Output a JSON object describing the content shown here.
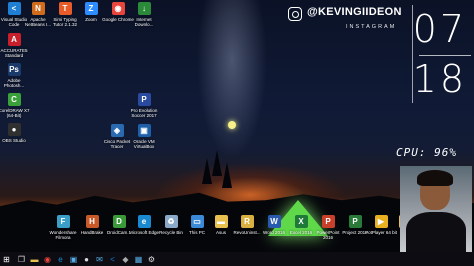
{
  "watermark": {
    "handle": "@KEVINGIIDEON",
    "platform": "INSTAGRAM"
  },
  "clock": {
    "hour": "07",
    "minute": "18"
  },
  "cpu_overlay": "CPU: 96%",
  "desktop_icons": [
    {
      "label": "Visual Studio Code",
      "icon": "vscode-icon",
      "color": "#1f7fd4",
      "glyph": "<"
    },
    {
      "label": "Apache NetBeans I...",
      "icon": "netbeans-icon",
      "color": "#d06c1c",
      "glyph": "N"
    },
    {
      "label": "Simi Typing Tutor 2.1.32",
      "icon": "typing-tutor-icon",
      "color": "#e85c2a",
      "glyph": "T"
    },
    {
      "label": "Zoom",
      "icon": "zoom-icon",
      "color": "#2d8cff",
      "glyph": "Z"
    },
    {
      "label": "Google Chrome",
      "icon": "chrome-icon",
      "color": "#e8453c",
      "glyph": "◉"
    },
    {
      "label": "Internet Downlo...",
      "icon": "internet-download-manager-icon",
      "color": "#2a8a3a",
      "glyph": "↓"
    },
    {
      "label": "ACCURATE5 Standard",
      "icon": "accurate-icon",
      "color": "#c8202a",
      "glyph": "A"
    },
    {
      "label": "Adobe Photosh...",
      "icon": "photoshop-icon",
      "color": "#1a3a6a",
      "glyph": "Ps"
    },
    {
      "label": "CorelDRAW X7 (64-Bit)",
      "icon": "coreldraw-icon",
      "color": "#3aa03a",
      "glyph": "C"
    },
    {
      "label": "OBS Studio",
      "icon": "obs-icon",
      "color": "#303030",
      "glyph": "●"
    },
    {
      "label": "Pro Evolution Soccer 2017",
      "icon": "pes-icon",
      "color": "#2a4aa0",
      "glyph": "P"
    },
    {
      "label": "Cisco Packet Tracer",
      "icon": "packet-tracer-icon",
      "color": "#2a6ab0",
      "glyph": "◈"
    },
    {
      "label": "Oracle VM VirtualBox",
      "icon": "virtualbox-icon",
      "color": "#1d5fa8",
      "glyph": "▣"
    },
    {
      "label": "Wondershare Filmora",
      "icon": "filmora-icon",
      "color": "#3aa0c8",
      "glyph": "F"
    },
    {
      "label": "HandBrake",
      "icon": "handbrake-icon",
      "color": "#c85a2a",
      "glyph": "H"
    },
    {
      "label": "DroidCam...",
      "icon": "droidcam-icon",
      "color": "#3a9a3a",
      "glyph": "D"
    },
    {
      "label": "Microsoft Edge",
      "icon": "edge-icon",
      "color": "#1a8ad0",
      "glyph": "e"
    },
    {
      "label": "Recycle Bin",
      "icon": "recycle-bin-icon",
      "color": "#8aa8c8",
      "glyph": "♻"
    },
    {
      "label": "This PC",
      "icon": "this-pc-icon",
      "color": "#3a8ad8",
      "glyph": "▭"
    },
    {
      "label": "Asus",
      "icon": "folder-icon",
      "color": "#e8c050",
      "glyph": "▬"
    },
    {
      "label": "RevoUninst...",
      "icon": "revo-uninstaller-icon",
      "color": "#d8b040",
      "glyph": "R"
    },
    {
      "label": "Word 2016",
      "icon": "word-icon",
      "color": "#2a5ab0",
      "glyph": "W"
    },
    {
      "label": "Excel 2016",
      "icon": "excel-icon",
      "color": "#1f7a3a",
      "glyph": "X"
    },
    {
      "label": "PowerPoint 2016",
      "icon": "powerpoint-icon",
      "color": "#c8402a",
      "glyph": "P"
    },
    {
      "label": "Project 2016",
      "icon": "project-icon",
      "color": "#2a7a3a",
      "glyph": "P"
    },
    {
      "label": "PotPlayer 64 bit",
      "icon": "potplayer-icon",
      "color": "#e8b020",
      "glyph": "▶"
    },
    {
      "label": "Fo...",
      "icon": "folder-icon",
      "color": "#e8c050",
      "glyph": "▬"
    }
  ],
  "taskbar": [
    {
      "icon": "windows-start-icon",
      "glyph": "⊞",
      "color": "#ffffff"
    },
    {
      "icon": "task-view-icon",
      "glyph": "❐",
      "color": "#dddddd"
    },
    {
      "icon": "explorer-icon",
      "glyph": "▬",
      "color": "#e8c050"
    },
    {
      "icon": "chrome-icon",
      "glyph": "◉",
      "color": "#e8453c"
    },
    {
      "icon": "edge-icon",
      "glyph": "e",
      "color": "#1a8ad0"
    },
    {
      "icon": "store-icon",
      "glyph": "▣",
      "color": "#5ab0e8"
    },
    {
      "icon": "obs-icon",
      "glyph": "●",
      "color": "#dddddd"
    },
    {
      "icon": "mail-icon",
      "glyph": "✉",
      "color": "#5ab0e8"
    },
    {
      "icon": "vscode-icon",
      "glyph": "<",
      "color": "#1f7fd4"
    },
    {
      "icon": "app-icon",
      "glyph": "◆",
      "color": "#aaaaaa"
    },
    {
      "icon": "photos-icon",
      "glyph": "▦",
      "color": "#5ab0e8"
    },
    {
      "icon": "settings-icon",
      "glyph": "⚙",
      "color": "#dddddd"
    }
  ]
}
